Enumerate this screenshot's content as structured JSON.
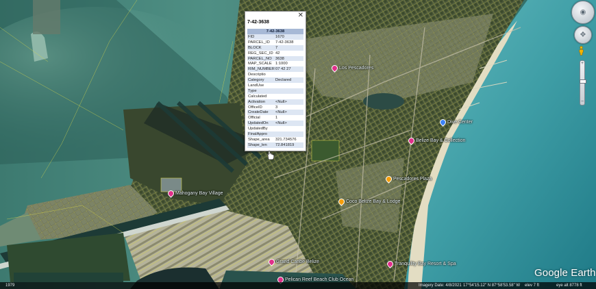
{
  "popup": {
    "title": "7-42-3638",
    "header": "7-42-3638",
    "close_glyph": "✕",
    "rows": [
      {
        "k": "FID",
        "v": "1670"
      },
      {
        "k": "PARCEL_ID",
        "v": "7-42-3638"
      },
      {
        "k": "BLOCK",
        "v": "7"
      },
      {
        "k": "REG_SEC_ID",
        "v": "42"
      },
      {
        "k": "PARCEL_NO",
        "v": "3638"
      },
      {
        "k": "MAP_SCALE",
        "v": "1:1000"
      },
      {
        "k": "RIM_NUMBER",
        "v": "07 42 27"
      },
      {
        "k": "Descriptio",
        "v": ""
      },
      {
        "k": "Category",
        "v": "Declared"
      },
      {
        "k": "LandUse",
        "v": ""
      },
      {
        "k": "Type",
        "v": ""
      },
      {
        "k": "Calculated",
        "v": ""
      },
      {
        "k": "Activation",
        "v": "<Null>"
      },
      {
        "k": "OfficeID",
        "v": "3"
      },
      {
        "k": "CreateDate",
        "v": "<Null>"
      },
      {
        "k": "Official",
        "v": "1"
      },
      {
        "k": "UpdatedOn",
        "v": "<Null>"
      },
      {
        "k": "UpdatedBy",
        "v": ""
      },
      {
        "k": "FinalAppro",
        "v": ""
      },
      {
        "k": "Shape_area",
        "v": "321.734576"
      },
      {
        "k": "Shape_len",
        "v": "72.841819"
      }
    ]
  },
  "pois": [
    {
      "label": "Los Pescadores",
      "color": "#e0308a",
      "icon": "pin-icon"
    },
    {
      "label": "Dive Center",
      "color": "#3b82f6",
      "icon": "pin-icon"
    },
    {
      "label": "Belize Bay & Collection",
      "color": "#e0308a",
      "icon": "pin-icon"
    },
    {
      "label": "Pescadores Plaza",
      "color": "#f59e0b",
      "icon": "pin-icon"
    },
    {
      "label": "Coco Belize Bay & Lodge",
      "color": "#f59e0b",
      "icon": "pin-icon"
    },
    {
      "label": "Mahogany Bay Village",
      "color": "#e0308a",
      "icon": "pin-icon"
    },
    {
      "label": "Grand Caribe Belize",
      "color": "#e0308a",
      "icon": "pin-icon"
    },
    {
      "label": "Tranquility Bay Resort & Spa",
      "color": "#e0308a",
      "icon": "pin-icon"
    },
    {
      "label": "Pelican Reef Beach Club Ocean",
      "color": "#e0308a",
      "icon": "pin-icon"
    }
  ],
  "logo": "Google Earth",
  "status": {
    "left": "1979",
    "imagery_date": "Imagery Date: 4/8/2021",
    "coords": "17°54'15.12\" N   87°58'53.58\" W",
    "elev": "elev   7 ft",
    "eye_alt": "eye alt  8778 ft"
  }
}
